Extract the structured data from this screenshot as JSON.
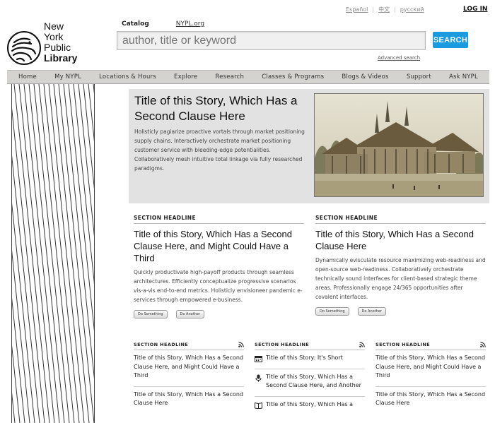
{
  "utility": {
    "languages": [
      "Español",
      "中文",
      "русский"
    ],
    "login": "LOG IN"
  },
  "logo": {
    "line1": "New York",
    "line2": "Public",
    "line3": "Library"
  },
  "search": {
    "tab_catalog": "Catalog",
    "tab_nypl": "NYPL.org",
    "placeholder": "author, title or keyword",
    "button": "SEARCH",
    "advanced": "Advanced search"
  },
  "nav": [
    "Home",
    "My NYPL",
    "Locations & Hours",
    "Explore",
    "Research",
    "Classes & Programs",
    "Blogs & Videos",
    "Support",
    "Ask NYPL"
  ],
  "hero": {
    "title": "Title of this Story, Which Has a Second Clause Here",
    "body": "Holisticly pagiarize proactive vortals through market positioning supply chains. Interactively orchestrate market positioning customer service with bleeding-edge potentialities. Collaboratively mesh intuitive total linkage via fully researched paradigms."
  },
  "sections": [
    {
      "headline": "SECTION HEADLINE",
      "title": "Title of this Story, Which Has a Second Clause Here, and Might Could Have a Third",
      "body": "Quickly productivate high-payoff products through seamless architectures. Efficiently conceptualize progressive scenarios vis-a-vis end-to-end metrics. Holisticly envisioneer pandemic e-services through empowered e-business.",
      "btn1": "Do Something",
      "btn2": "Do Another"
    },
    {
      "headline": "SECTION HEADLINE",
      "title": "Title of this Story, Which Has a Second Clause Here",
      "body": "Dynamically evisculate resource maximizing web-readiness and open-source web-readiness. Collaboratively orchestrate technically sound interfaces for client-based strategic theme areas. Professionally engage 24/365 opportunities after covalent interfaces.",
      "btn1": "Do Something",
      "btn2": "Do Another"
    }
  ],
  "columns": [
    {
      "headline": "SECTION HEADLINE",
      "items": [
        "Title of this Story, Which Has a Second Clause Here, and Might Could Have a Third",
        "Title of this Story, Which Has a Second Clause Here"
      ]
    },
    {
      "headline": "SECTION HEADLINE",
      "items": [
        {
          "icon": "calendar-icon",
          "text": "Title of this Story: It's Short"
        },
        {
          "icon": "microphone-icon",
          "text": "Title of this Story, Which Has a Second Clause Here, and Another"
        },
        {
          "icon": "book-icon",
          "text": "Title of this Story, Which Has a"
        }
      ]
    },
    {
      "headline": "SECTION HEADLINE",
      "items": [
        "Title of this Story, Which Has a Second Clause Here, and Might Could Have a Third",
        "Title of this Story, Which Has a Second Clause Here"
      ]
    }
  ],
  "colors": {
    "search_button": "#1a9be0",
    "nav_bg": "#d4d3d0",
    "hero_bg": "#e2e2e2",
    "rss": "#222222"
  }
}
